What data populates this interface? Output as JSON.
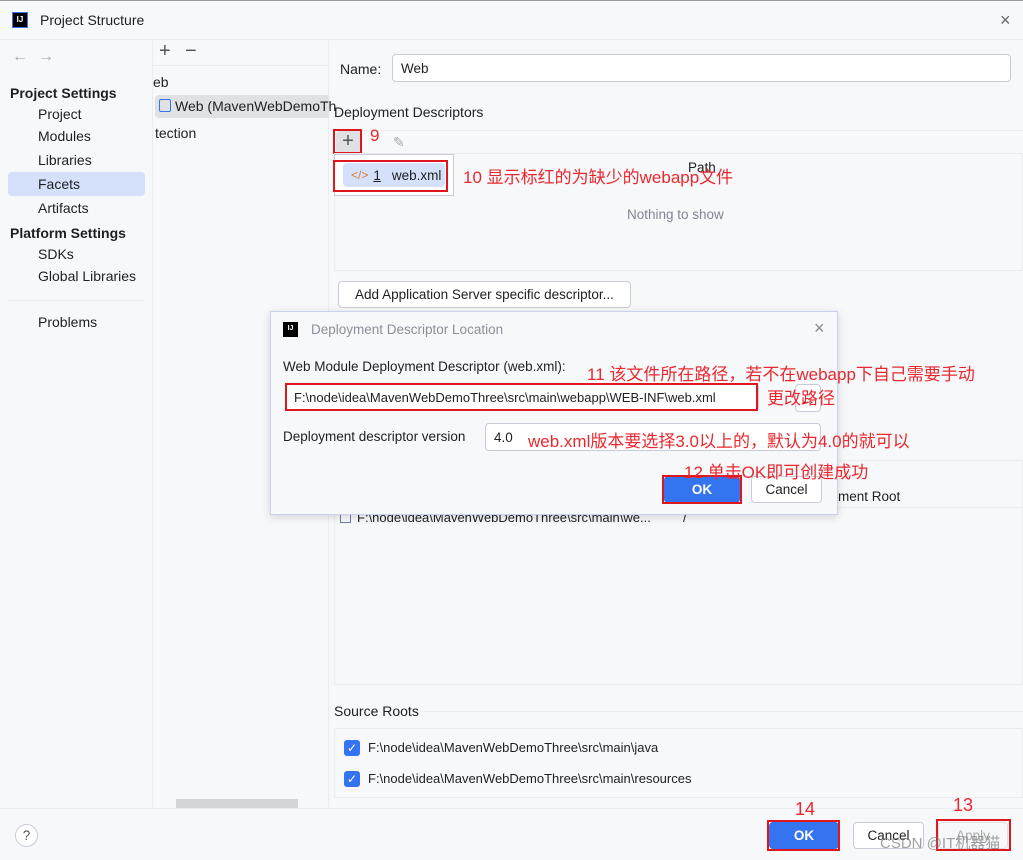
{
  "window": {
    "title": "Project Structure",
    "close_icon": "close-icon"
  },
  "sidebar": {
    "back": "←",
    "forward": "→",
    "groups": [
      {
        "label": "Project Settings",
        "items": [
          "Project",
          "Modules",
          "Libraries",
          "Facets",
          "Artifacts"
        ]
      },
      {
        "label": "Platform Settings",
        "items": [
          "SDKs",
          "Global Libraries"
        ]
      }
    ],
    "problems": "Problems",
    "selected": "Facets"
  },
  "middle": {
    "add": "+",
    "remove": "−",
    "items": [
      "eb",
      "Web (MavenWebDemoTh",
      "tection"
    ]
  },
  "main": {
    "name_label": "Name:",
    "name_value": "Web",
    "deployment_descriptors": "Deployment Descriptors",
    "table_header_path": "Path",
    "empty_text": "Nothing to show",
    "popup_item_number": "1",
    "popup_item_label": "web.xml",
    "add_server_descriptor": "Add Application Server specific descriptor...",
    "web_root_header": "ment Root",
    "web_root_path": "F:\\node\\idea\\MavenWebDemoThree\\src\\main\\we...",
    "web_root_relative": "/",
    "source_roots": "Source Roots",
    "source_root_items": [
      {
        "path": "F:\\node\\idea\\MavenWebDemoThree\\src\\main\\java",
        "checked": true
      },
      {
        "path": "F:\\node\\idea\\MavenWebDemoThree\\src\\main\\resources",
        "checked": true
      }
    ]
  },
  "dialog": {
    "title": "Deployment Descriptor Location",
    "descriptor_label": "Web Module Deployment Descriptor (web.xml):",
    "descriptor_path": "F:\\node\\idea\\MavenWebDemoThree\\src\\main\\webapp\\WEB-INF\\web.xml",
    "browse": "...",
    "version_label": "Deployment descriptor version",
    "version_value": "4.0",
    "ok": "OK",
    "cancel": "Cancel"
  },
  "footer": {
    "help": "?",
    "ok": "OK",
    "cancel": "Cancel",
    "apply": "Apply"
  },
  "annotations": {
    "a9": "9",
    "a10": "10 显示标红的为缺少的webapp文件",
    "a11": "11 该文件所在路径，若不在webapp下自己需要手动",
    "a11b": "更改路径",
    "a_version": "web.xml版本要选择3.0以上的，默认为4.0的就可以",
    "a12": "12 单击OK即可创建成功",
    "a13": "13",
    "a14": "14"
  },
  "watermark": "CSDN @IT机器猫",
  "colors": {
    "accent": "#3574f0",
    "annotation": "#e0161e",
    "selection": "#d5e1fb"
  }
}
